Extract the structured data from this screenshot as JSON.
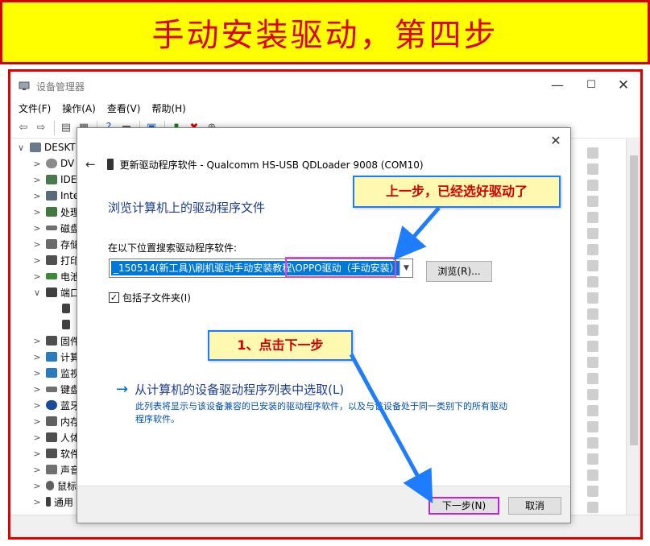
{
  "banner": {
    "title": "手动安装驱动，第四步"
  },
  "window": {
    "title": "设备管理器",
    "menu": [
      "文件(F)",
      "操作(A)",
      "查看(V)",
      "帮助(H)"
    ],
    "tree": [
      {
        "label": "DESKT",
        "chevron": "∨"
      },
      {
        "label": "DV",
        "chevron": ">"
      },
      {
        "label": "IDE",
        "chevron": ">"
      },
      {
        "label": "Inte",
        "chevron": ">"
      },
      {
        "label": "处理",
        "chevron": ">"
      },
      {
        "label": "磁盘",
        "chevron": ">"
      },
      {
        "label": "存储",
        "chevron": ">"
      },
      {
        "label": "打印",
        "chevron": ">"
      },
      {
        "label": "电池",
        "chevron": ">"
      },
      {
        "label": "端口",
        "chevron": "∨"
      },
      {
        "label": "",
        "chevron": ""
      },
      {
        "label": "",
        "chevron": ""
      },
      {
        "label": "固件",
        "chevron": ">"
      },
      {
        "label": "计算",
        "chevron": ">"
      },
      {
        "label": "监视",
        "chevron": ">"
      },
      {
        "label": "键盘",
        "chevron": ">"
      },
      {
        "label": "蓝牙",
        "chevron": ">"
      },
      {
        "label": "内存",
        "chevron": ">"
      },
      {
        "label": "人体",
        "chevron": ">"
      },
      {
        "label": "软件",
        "chevron": ">"
      },
      {
        "label": "声音",
        "chevron": ">"
      },
      {
        "label": "鼠标",
        "chevron": ">"
      },
      {
        "label": "通用",
        "chevron": ">"
      }
    ]
  },
  "dialog": {
    "header_title": "更新驱动程序软件 - Qualcomm HS-USB QDLoader 9008 (COM10)",
    "heading": "浏览计算机上的驱动程序文件",
    "search_label": "在以下位置搜索驱动程序软件:",
    "path_value": "_150514(新工具)\\刷机驱动手动安装教程\\OPPO驱动（手动安装）",
    "browse_label": "浏览(R)...",
    "include_subfolders_label": "包括子文件夹(I)",
    "include_subfolders_checked": true,
    "pick_link_title": "从计算机的设备驱动程序列表中选取(L)",
    "pick_link_desc": "此列表将显示与该设备兼容的已安装的驱动程序软件，以及与该设备处于同一类别下的所有驱动程序软件。",
    "next_label": "下一步(N)",
    "cancel_label": "取消"
  },
  "callouts": {
    "top": "上一步，已经选好驱动了",
    "bottom": "1、点击下一步"
  },
  "colors": {
    "banner_bg": "#ffff00",
    "banner_text": "#e00000",
    "frame_border": "#e00000",
    "callout_border": "#1e7cff",
    "highlight_magenta": "#e040e0",
    "selection_blue": "#0078d7"
  }
}
